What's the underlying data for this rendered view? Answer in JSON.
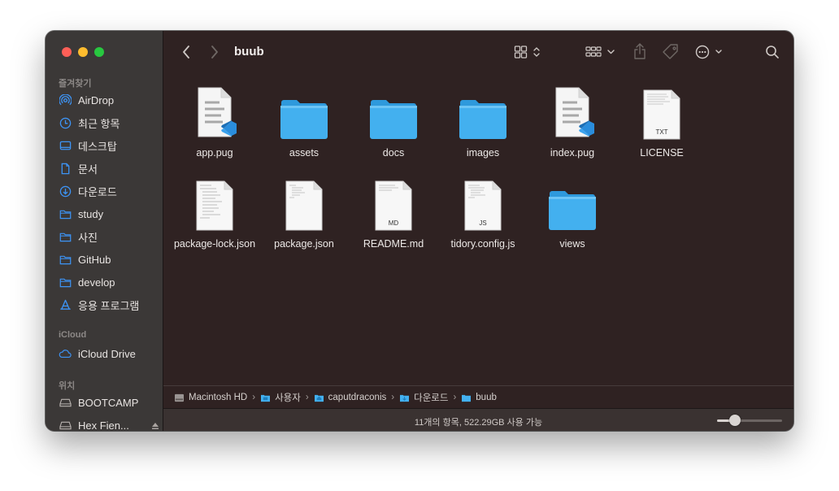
{
  "window": {
    "title": "buub"
  },
  "sidebar": {
    "favorites_label": "즐겨찾기",
    "favorites": [
      {
        "label": "AirDrop",
        "icon": "airdrop-icon"
      },
      {
        "label": "최근 항목",
        "icon": "clock-icon"
      },
      {
        "label": "데스크탑",
        "icon": "desktop-icon"
      },
      {
        "label": "문서",
        "icon": "document-icon"
      },
      {
        "label": "다운로드",
        "icon": "download-icon"
      },
      {
        "label": "study",
        "icon": "folder-icon"
      },
      {
        "label": "사진",
        "icon": "folder-icon"
      },
      {
        "label": "GitHub",
        "icon": "folder-icon"
      },
      {
        "label": "develop",
        "icon": "folder-icon"
      },
      {
        "label": "응용 프로그램",
        "icon": "applications-icon"
      }
    ],
    "icloud_label": "iCloud",
    "icloud": [
      {
        "label": "iCloud Drive",
        "icon": "cloud-icon"
      }
    ],
    "locations_label": "위치",
    "locations": [
      {
        "label": "BOOTCAMP",
        "icon": "disk-icon"
      },
      {
        "label": "Hex Fien...",
        "icon": "disk-icon"
      }
    ]
  },
  "files": [
    {
      "name": "app.pug",
      "type": "vscode-doc"
    },
    {
      "name": "assets",
      "type": "folder"
    },
    {
      "name": "docs",
      "type": "folder"
    },
    {
      "name": "images",
      "type": "folder"
    },
    {
      "name": "index.pug",
      "type": "vscode-doc"
    },
    {
      "name": "LICENSE",
      "type": "txt",
      "badge": "TXT"
    },
    {
      "name": "package-lock.json",
      "type": "json"
    },
    {
      "name": "package.json",
      "type": "json"
    },
    {
      "name": "README.md",
      "type": "md",
      "badge": "MD"
    },
    {
      "name": "tidory.config.js",
      "type": "js",
      "badge": "JS"
    },
    {
      "name": "views",
      "type": "folder"
    }
  ],
  "pathbar": [
    {
      "label": "Macintosh HD",
      "icon": "hard-drive-icon"
    },
    {
      "label": "사용자",
      "icon": "folder-icon"
    },
    {
      "label": "caputdraconis",
      "icon": "home-folder-icon"
    },
    {
      "label": "다운로드",
      "icon": "download-folder-icon"
    },
    {
      "label": "buub",
      "icon": "folder-icon"
    }
  ],
  "pathbar_separator": "›",
  "status": {
    "text": "11개의 항목, 522.29GB 사용 가능",
    "icon_size_fraction": 0.27
  },
  "colors": {
    "folder": "#43b0ef",
    "folder_tab": "#2e99dc",
    "accent": "#2f8cf6"
  }
}
